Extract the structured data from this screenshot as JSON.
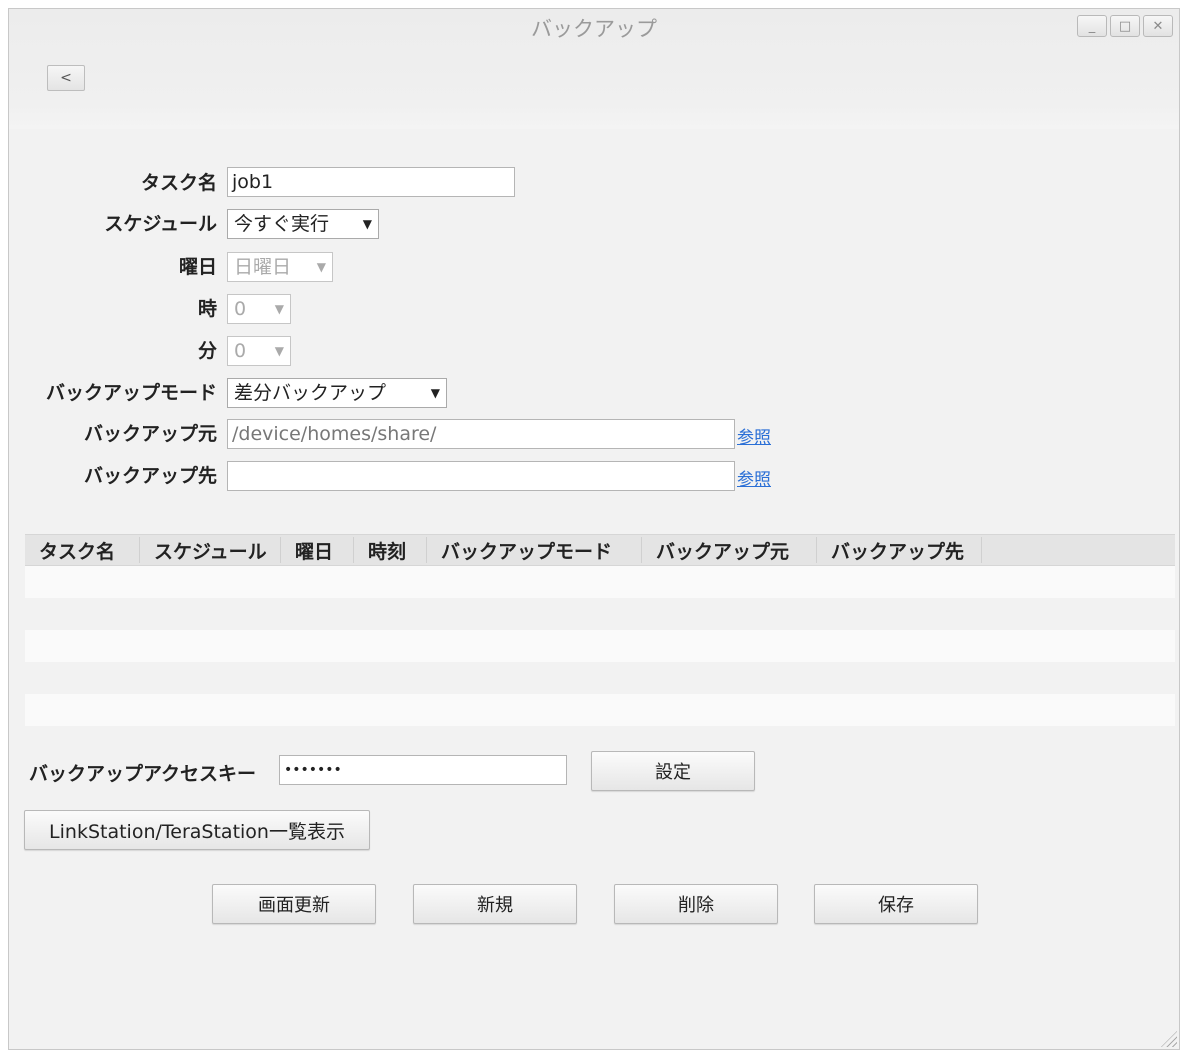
{
  "window": {
    "title": "バックアップ",
    "controls": [
      "minimize",
      "maximize",
      "close"
    ]
  },
  "back_label": "<",
  "form": {
    "task_name_label": "タスク名",
    "task_name_value": "job1",
    "schedule_label": "スケジュール",
    "schedule_value": "今すぐ実行",
    "weekday_label": "曜日",
    "weekday_value": "日曜日",
    "hour_label": "時",
    "hour_value": "0",
    "minute_label": "分",
    "minute_value": "0",
    "mode_label": "バックアップモード",
    "mode_value": "差分バックアップ",
    "source_label": "バックアップ元",
    "source_value": "/device/homes/share/",
    "dest_label": "バックアップ先",
    "dest_value": "",
    "browse_label": "参照"
  },
  "table": {
    "columns": [
      "タスク名",
      "スケジュール",
      "曜日",
      "時刻",
      "バックアップモード",
      "バックアップ元",
      "バックアップ先"
    ],
    "rows": []
  },
  "access_key": {
    "label": "バックアップアクセスキー",
    "value": "•••••••",
    "set_label": "設定"
  },
  "list_button_label": "LinkStation/TeraStation一覧表示",
  "actions": {
    "refresh": "画面更新",
    "new": "新規",
    "delete": "削除",
    "save": "保存"
  }
}
